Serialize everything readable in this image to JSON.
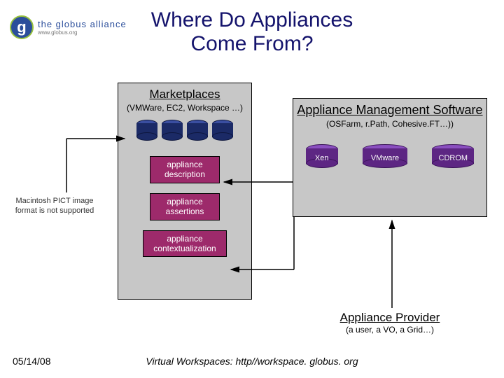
{
  "logo": {
    "alliance": "the globus alliance",
    "url": "www.globus.org",
    "mark": "g"
  },
  "title_line1": "Where Do Appliances",
  "title_line2": "Come From?",
  "marketplace": {
    "heading": "Marketplaces",
    "sub": "(VMWare, EC2, Workspace …)",
    "box_desc": "appliance description",
    "box_assert": "appliance assertions",
    "box_context": "appliance contextualization"
  },
  "mgmt": {
    "heading": "Appliance Management Software",
    "sub": "(OSFarm, r.Path, Cohesive.FT…))",
    "items": [
      {
        "label": "Xen"
      },
      {
        "label": "VMware"
      },
      {
        "label": "CDROM"
      }
    ]
  },
  "provider": {
    "heading": "Appliance Provider",
    "sub": "(a user, a VO, a Grid…)"
  },
  "pict_placeholder": "Macintosh PICT image format is not supported",
  "footer": {
    "date": "05/14/08",
    "credit": "Virtual Workspaces: http//workspace. globus. org"
  }
}
